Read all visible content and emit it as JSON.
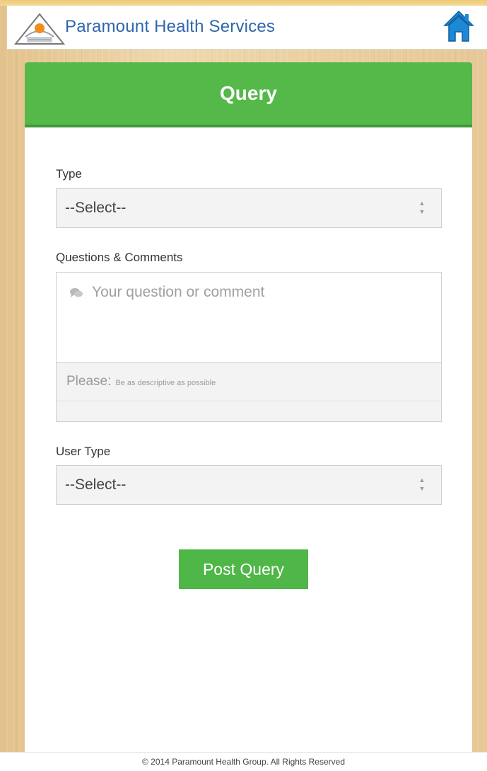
{
  "header": {
    "app_title": "Paramount Health Services",
    "logo_icon": "paramount-logo-icon",
    "home_icon": "home-icon"
  },
  "card": {
    "title": "Query"
  },
  "form": {
    "type": {
      "label": "Type",
      "selected": "--Select--"
    },
    "questions": {
      "label": "Questions & Comments",
      "placeholder": "Your question or comment",
      "icon": "chat-bubble-icon",
      "hint_strong": "Please:",
      "hint_text": "Be as descriptive as possible"
    },
    "user_type": {
      "label": "User Type",
      "selected": "--Select--"
    },
    "submit_label": "Post Query"
  },
  "footer": {
    "text": "© 2014 Paramount Health Group. All Rights Reserved"
  },
  "colors": {
    "accent_green": "#55b94a",
    "title_blue": "#2f66ad",
    "home_blue": "#1e88d6"
  }
}
